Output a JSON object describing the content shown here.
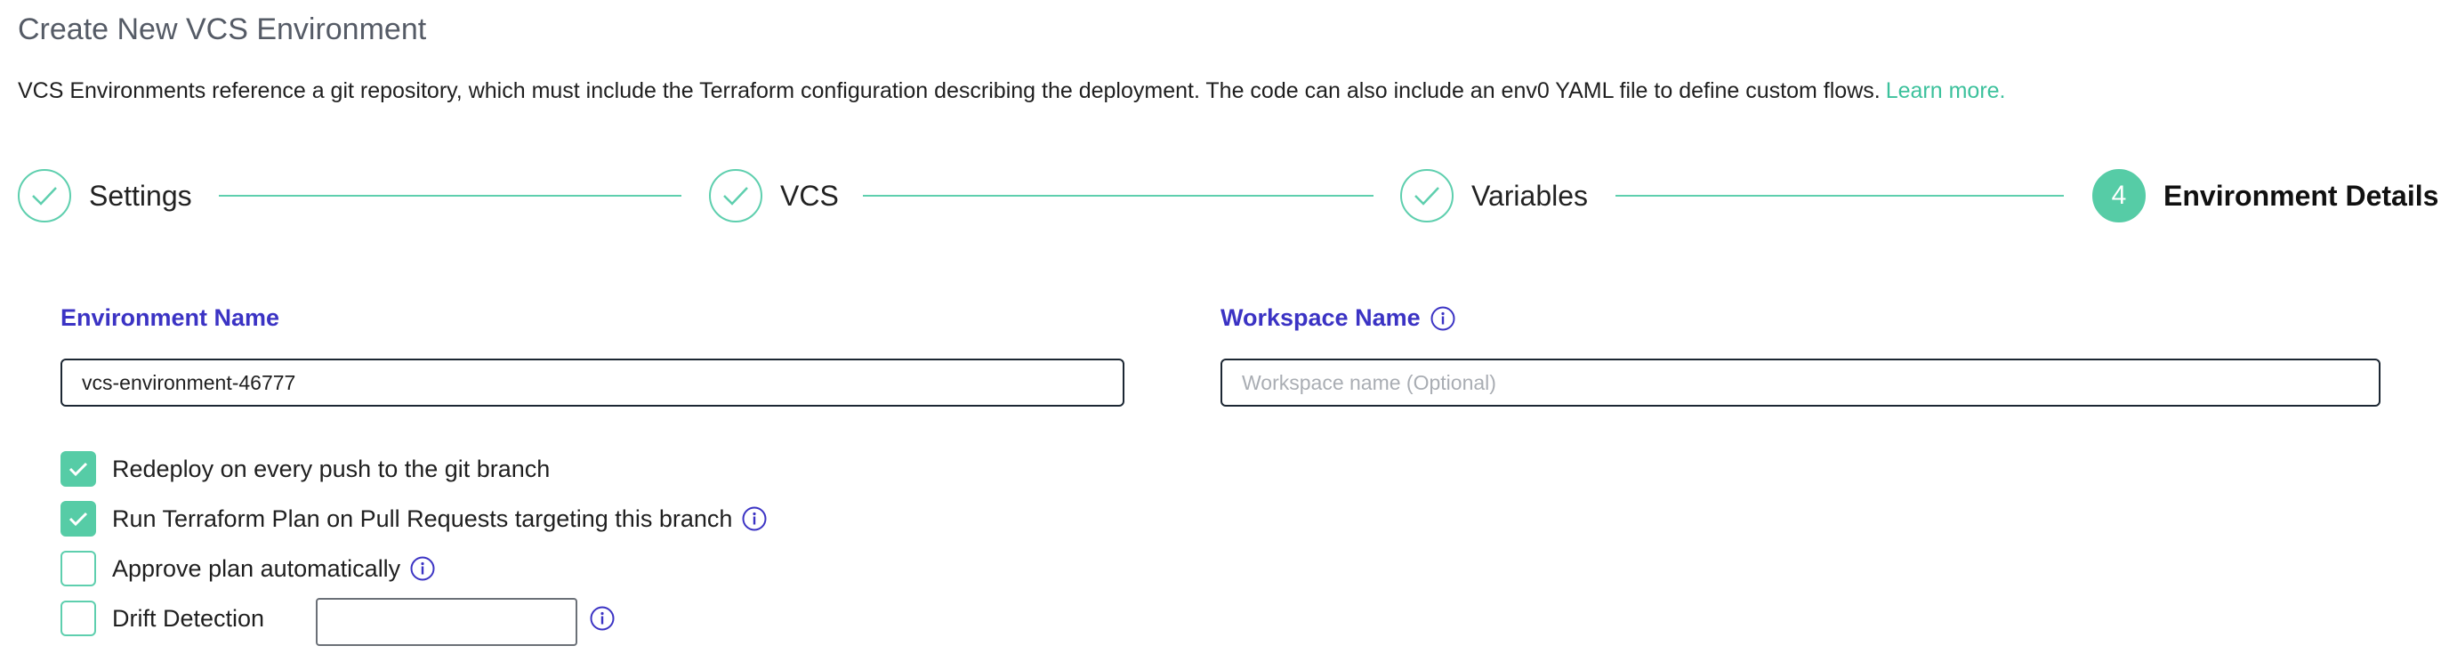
{
  "page": {
    "title": "Create New VCS Environment",
    "description": "VCS Environments reference a git repository, which must include the Terraform configuration describing the deployment. The code can also include an env0 YAML file to define custom flows.",
    "learn_more": "Learn more."
  },
  "stepper": {
    "steps": [
      {
        "label": "Settings",
        "state": "completed",
        "icon": "check-icon"
      },
      {
        "label": "VCS",
        "state": "completed",
        "icon": "check-icon"
      },
      {
        "label": "Variables",
        "state": "completed",
        "icon": "check-icon"
      },
      {
        "label": "Environment Details",
        "state": "active",
        "number": "4"
      }
    ]
  },
  "form": {
    "environment_name": {
      "label": "Environment Name",
      "value": "vcs-environment-46777"
    },
    "workspace_name": {
      "label": "Workspace Name",
      "value": "",
      "placeholder": "Workspace name (Optional)",
      "icon": "info-icon"
    },
    "options": [
      {
        "label": "Redeploy on every push to the git branch",
        "checked": true
      },
      {
        "label": "Run Terraform Plan on Pull Requests targeting this branch",
        "checked": true,
        "icon": "info-icon"
      },
      {
        "label": "Approve plan automatically",
        "checked": false,
        "icon": "info-icon"
      },
      {
        "label": "Drift Detection",
        "checked": false,
        "input_value": "",
        "icon": "info-icon"
      }
    ]
  },
  "colors": {
    "accent_green": "#56cca6",
    "label_blue": "#3b33c4",
    "link_green": "#3cc19c"
  }
}
